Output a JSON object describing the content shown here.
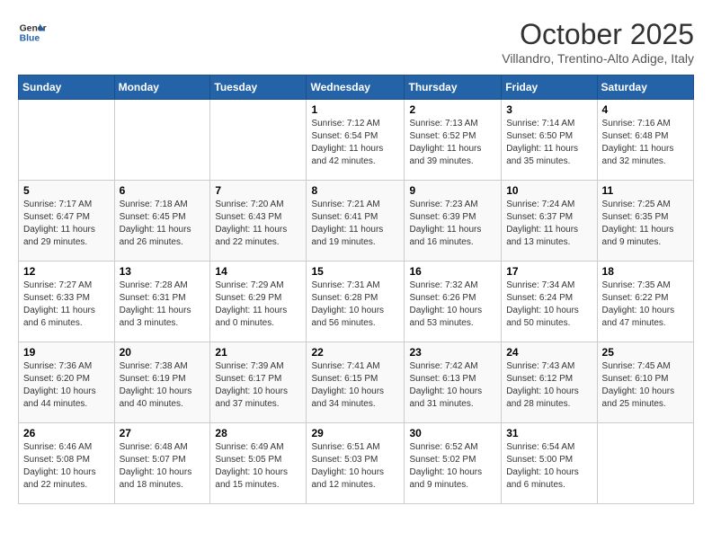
{
  "header": {
    "logo_line1": "General",
    "logo_line2": "Blue",
    "title": "October 2025",
    "subtitle": "Villandro, Trentino-Alto Adige, Italy"
  },
  "days_of_week": [
    "Sunday",
    "Monday",
    "Tuesday",
    "Wednesday",
    "Thursday",
    "Friday",
    "Saturday"
  ],
  "weeks": [
    [
      {
        "day": "",
        "info": ""
      },
      {
        "day": "",
        "info": ""
      },
      {
        "day": "",
        "info": ""
      },
      {
        "day": "1",
        "info": "Sunrise: 7:12 AM\nSunset: 6:54 PM\nDaylight: 11 hours and 42 minutes."
      },
      {
        "day": "2",
        "info": "Sunrise: 7:13 AM\nSunset: 6:52 PM\nDaylight: 11 hours and 39 minutes."
      },
      {
        "day": "3",
        "info": "Sunrise: 7:14 AM\nSunset: 6:50 PM\nDaylight: 11 hours and 35 minutes."
      },
      {
        "day": "4",
        "info": "Sunrise: 7:16 AM\nSunset: 6:48 PM\nDaylight: 11 hours and 32 minutes."
      }
    ],
    [
      {
        "day": "5",
        "info": "Sunrise: 7:17 AM\nSunset: 6:47 PM\nDaylight: 11 hours and 29 minutes."
      },
      {
        "day": "6",
        "info": "Sunrise: 7:18 AM\nSunset: 6:45 PM\nDaylight: 11 hours and 26 minutes."
      },
      {
        "day": "7",
        "info": "Sunrise: 7:20 AM\nSunset: 6:43 PM\nDaylight: 11 hours and 22 minutes."
      },
      {
        "day": "8",
        "info": "Sunrise: 7:21 AM\nSunset: 6:41 PM\nDaylight: 11 hours and 19 minutes."
      },
      {
        "day": "9",
        "info": "Sunrise: 7:23 AM\nSunset: 6:39 PM\nDaylight: 11 hours and 16 minutes."
      },
      {
        "day": "10",
        "info": "Sunrise: 7:24 AM\nSunset: 6:37 PM\nDaylight: 11 hours and 13 minutes."
      },
      {
        "day": "11",
        "info": "Sunrise: 7:25 AM\nSunset: 6:35 PM\nDaylight: 11 hours and 9 minutes."
      }
    ],
    [
      {
        "day": "12",
        "info": "Sunrise: 7:27 AM\nSunset: 6:33 PM\nDaylight: 11 hours and 6 minutes."
      },
      {
        "day": "13",
        "info": "Sunrise: 7:28 AM\nSunset: 6:31 PM\nDaylight: 11 hours and 3 minutes."
      },
      {
        "day": "14",
        "info": "Sunrise: 7:29 AM\nSunset: 6:29 PM\nDaylight: 11 hours and 0 minutes."
      },
      {
        "day": "15",
        "info": "Sunrise: 7:31 AM\nSunset: 6:28 PM\nDaylight: 10 hours and 56 minutes."
      },
      {
        "day": "16",
        "info": "Sunrise: 7:32 AM\nSunset: 6:26 PM\nDaylight: 10 hours and 53 minutes."
      },
      {
        "day": "17",
        "info": "Sunrise: 7:34 AM\nSunset: 6:24 PM\nDaylight: 10 hours and 50 minutes."
      },
      {
        "day": "18",
        "info": "Sunrise: 7:35 AM\nSunset: 6:22 PM\nDaylight: 10 hours and 47 minutes."
      }
    ],
    [
      {
        "day": "19",
        "info": "Sunrise: 7:36 AM\nSunset: 6:20 PM\nDaylight: 10 hours and 44 minutes."
      },
      {
        "day": "20",
        "info": "Sunrise: 7:38 AM\nSunset: 6:19 PM\nDaylight: 10 hours and 40 minutes."
      },
      {
        "day": "21",
        "info": "Sunrise: 7:39 AM\nSunset: 6:17 PM\nDaylight: 10 hours and 37 minutes."
      },
      {
        "day": "22",
        "info": "Sunrise: 7:41 AM\nSunset: 6:15 PM\nDaylight: 10 hours and 34 minutes."
      },
      {
        "day": "23",
        "info": "Sunrise: 7:42 AM\nSunset: 6:13 PM\nDaylight: 10 hours and 31 minutes."
      },
      {
        "day": "24",
        "info": "Sunrise: 7:43 AM\nSunset: 6:12 PM\nDaylight: 10 hours and 28 minutes."
      },
      {
        "day": "25",
        "info": "Sunrise: 7:45 AM\nSunset: 6:10 PM\nDaylight: 10 hours and 25 minutes."
      }
    ],
    [
      {
        "day": "26",
        "info": "Sunrise: 6:46 AM\nSunset: 5:08 PM\nDaylight: 10 hours and 22 minutes."
      },
      {
        "day": "27",
        "info": "Sunrise: 6:48 AM\nSunset: 5:07 PM\nDaylight: 10 hours and 18 minutes."
      },
      {
        "day": "28",
        "info": "Sunrise: 6:49 AM\nSunset: 5:05 PM\nDaylight: 10 hours and 15 minutes."
      },
      {
        "day": "29",
        "info": "Sunrise: 6:51 AM\nSunset: 5:03 PM\nDaylight: 10 hours and 12 minutes."
      },
      {
        "day": "30",
        "info": "Sunrise: 6:52 AM\nSunset: 5:02 PM\nDaylight: 10 hours and 9 minutes."
      },
      {
        "day": "31",
        "info": "Sunrise: 6:54 AM\nSunset: 5:00 PM\nDaylight: 10 hours and 6 minutes."
      },
      {
        "day": "",
        "info": ""
      }
    ]
  ]
}
